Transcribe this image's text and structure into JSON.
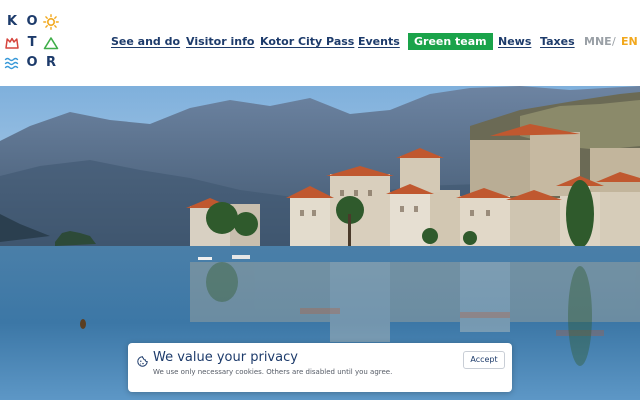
{
  "logo": {
    "letters": [
      "K",
      "O",
      "T",
      "O",
      "R"
    ],
    "icons": [
      "sun-icon",
      "crown-icon",
      "mountain-icon",
      "waves-icon"
    ]
  },
  "nav": {
    "items": [
      "See and do",
      "Visitor info",
      "Kotor City Pass",
      "Events"
    ],
    "green_team": "Green team",
    "items_after": [
      "News",
      "Taxes"
    ]
  },
  "lang": {
    "inactive": "MNE",
    "separator": "/",
    "active": "EN"
  },
  "cookie": {
    "icon": "cookie-icon",
    "title": "We value your privacy",
    "text": "We use only necessary cookies. Others are disabled until you agree.",
    "accept_label": "Accept"
  },
  "colors": {
    "brand_navy": "#1d3b6b",
    "green_team": "#1aa34a",
    "accent_orange": "#f2a81d",
    "waves_blue": "#3a9ad9",
    "mountain_green": "#3fae49",
    "crown_red": "#d6453d",
    "lang_inactive": "#9aa0a6"
  }
}
